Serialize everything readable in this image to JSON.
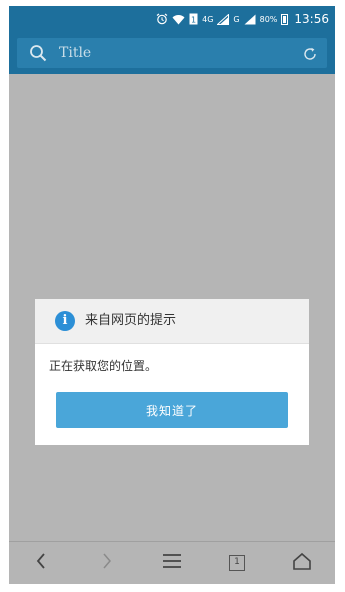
{
  "status_bar": {
    "network_label": "4G",
    "signal2_label": "G",
    "battery_percent": "80%",
    "time": "13:56"
  },
  "toolbar": {
    "title": "Title"
  },
  "dialog": {
    "title": "来自网页的提示",
    "message": "正在获取您的位置。",
    "ok_label": "我知道了"
  },
  "bottom_nav": {
    "tab_count": "1",
    "back_enabled": true,
    "forward_enabled": false
  },
  "colors": {
    "toolbar_bg": "#1d6f9c",
    "overlay": "#b5b5b5",
    "button": "#4aa6d9",
    "info_icon": "#2c8fd6"
  }
}
